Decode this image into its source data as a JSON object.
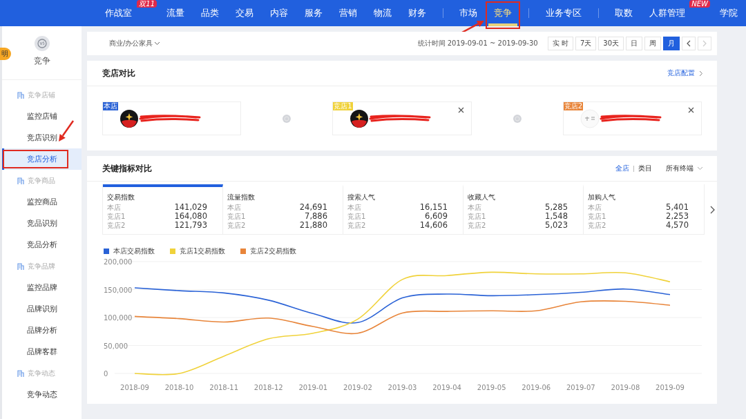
{
  "top_nav": {
    "groups": [
      {
        "items": [
          {
            "label": "作战室",
            "badge": "双11",
            "selected": false,
            "highlighted": false
          },
          {
            "label": "流量",
            "selected": false,
            "highlighted": false
          },
          {
            "label": "品类",
            "selected": false,
            "highlighted": false
          },
          {
            "label": "交易",
            "selected": false,
            "highlighted": false
          },
          {
            "label": "内容",
            "selected": false,
            "highlighted": false
          },
          {
            "label": "服务",
            "selected": false,
            "highlighted": false
          },
          {
            "label": "营销",
            "selected": false,
            "highlighted": false
          },
          {
            "label": "物流",
            "selected": false,
            "highlighted": false
          },
          {
            "label": "财务",
            "selected": false,
            "highlighted": false
          }
        ]
      },
      {
        "items": [
          {
            "label": "市场",
            "selected": false,
            "highlighted": false
          },
          {
            "label": "竞争",
            "selected": true,
            "highlighted": true
          }
        ]
      },
      {
        "items": [
          {
            "label": "业务专区",
            "selected": false,
            "highlighted": false
          }
        ]
      },
      {
        "items": [
          {
            "label": "取数",
            "selected": false,
            "highlighted": false
          },
          {
            "label": "人群管理",
            "badge": "NEW",
            "selected": false,
            "highlighted": false
          },
          {
            "label": "学院",
            "selected": false,
            "highlighted": false
          }
        ]
      }
    ]
  },
  "side_tab": "明",
  "sidebar": {
    "title": "竞争",
    "groups": [
      {
        "label": "竞争店铺",
        "items": [
          {
            "label": "监控店铺",
            "selected": false,
            "highlighted": false
          },
          {
            "label": "竞店识别",
            "selected": false,
            "highlighted": false
          },
          {
            "label": "竞店分析",
            "selected": true,
            "highlighted": true
          }
        ]
      },
      {
        "label": "竞争商品",
        "items": [
          {
            "label": "监控商品",
            "selected": false,
            "highlighted": false
          },
          {
            "label": "竞品识别",
            "selected": false,
            "highlighted": false
          },
          {
            "label": "竞品分析",
            "selected": false,
            "highlighted": false
          }
        ]
      },
      {
        "label": "竞争品牌",
        "items": [
          {
            "label": "监控品牌",
            "selected": false,
            "highlighted": false
          },
          {
            "label": "品牌识别",
            "selected": false,
            "highlighted": false
          },
          {
            "label": "品牌分析",
            "selected": false,
            "highlighted": false
          },
          {
            "label": "品牌客群",
            "selected": false,
            "highlighted": false
          }
        ]
      },
      {
        "label": "竞争动态",
        "items": [
          {
            "label": "竞争动态",
            "selected": false,
            "highlighted": false
          }
        ]
      }
    ]
  },
  "filter_bar": {
    "category": "商业/办公家具",
    "period": "统计时间 2019-09-01 ~ 2019-09-30",
    "ranges": [
      {
        "label": "实 时",
        "selected": false
      },
      {
        "label": "7天",
        "selected": false
      },
      {
        "label": "30天",
        "selected": false
      },
      {
        "label": "日",
        "selected": false
      },
      {
        "label": "周",
        "selected": false
      },
      {
        "label": "月",
        "selected": true
      }
    ],
    "prev_disabled": false,
    "next_disabled": true
  },
  "store_compare": {
    "title": "竞店对比",
    "link": "竞店配置",
    "stores": [
      {
        "tag": "本店",
        "color": "#2a62d6",
        "logo_dark": true,
        "removable": false
      },
      {
        "tag": "竞店1",
        "color": "#f0d23a",
        "logo_dark": true,
        "removable": true
      },
      {
        "tag": "竞店2",
        "color": "#e8853a",
        "logo_dark": false,
        "removable": true
      }
    ]
  },
  "key_metrics": {
    "title": "关键指标对比",
    "scopes": [
      {
        "label": "全店",
        "selected": true
      },
      {
        "label": "类目",
        "selected": false
      }
    ],
    "terminal": "所有终端",
    "metrics": [
      {
        "name": "交易指数",
        "selected": true,
        "rows": [
          {
            "label": "本店",
            "value": "141,029"
          },
          {
            "label": "竞店1",
            "value": "164,080"
          },
          {
            "label": "竞店2",
            "value": "121,793"
          }
        ]
      },
      {
        "name": "流量指数",
        "selected": false,
        "rows": [
          {
            "label": "本店",
            "value": "24,691"
          },
          {
            "label": "竞店1",
            "value": "7,886"
          },
          {
            "label": "竞店2",
            "value": "21,880"
          }
        ]
      },
      {
        "name": "搜索人气",
        "selected": false,
        "rows": [
          {
            "label": "本店",
            "value": "16,151"
          },
          {
            "label": "竞店1",
            "value": "6,609"
          },
          {
            "label": "竞店2",
            "value": "14,606"
          }
        ]
      },
      {
        "name": "收藏人气",
        "selected": false,
        "rows": [
          {
            "label": "本店",
            "value": "5,285"
          },
          {
            "label": "竞店1",
            "value": "1,548"
          },
          {
            "label": "竞店2",
            "value": "5,023"
          }
        ]
      },
      {
        "name": "加购人气",
        "selected": false,
        "rows": [
          {
            "label": "本店",
            "value": "5,401"
          },
          {
            "label": "竞店1",
            "value": "2,253"
          },
          {
            "label": "竞店2",
            "value": "4,570"
          }
        ]
      }
    ],
    "chart_data": {
      "type": "line",
      "grid": true,
      "legend": "top",
      "categories": [
        "2018-09",
        "2018-10",
        "2018-11",
        "2018-12",
        "2019-01",
        "2019-02",
        "2019-03",
        "2019-04",
        "2019-05",
        "2019-06",
        "2019-07",
        "2019-08",
        "2019-09"
      ],
      "ylim": [
        0,
        200000
      ],
      "yticks": [
        {
          "value": 0,
          "label": "0"
        },
        {
          "value": 50000,
          "label": "50,000"
        },
        {
          "value": 100000,
          "label": "100,000"
        },
        {
          "value": 150000,
          "label": "150,000"
        },
        {
          "value": 200000,
          "label": "200,000"
        }
      ],
      "series": [
        {
          "name": "本店交易指数",
          "color": "#2a62d6",
          "values": [
            153000,
            148000,
            144000,
            131000,
            107000,
            91000,
            135000,
            142000,
            139000,
            141000,
            145000,
            151000,
            141000
          ]
        },
        {
          "name": "竞店1交易指数",
          "color": "#f0d23a",
          "values": [
            0,
            0,
            31000,
            62000,
            72000,
            97000,
            168000,
            175000,
            181000,
            178000,
            178000,
            180000,
            164000
          ]
        },
        {
          "name": "竞店2交易指数",
          "color": "#e8853a",
          "values": [
            102000,
            98000,
            92000,
            99000,
            84000,
            72000,
            108000,
            111000,
            112000,
            112000,
            128000,
            129000,
            122000
          ]
        }
      ]
    }
  }
}
